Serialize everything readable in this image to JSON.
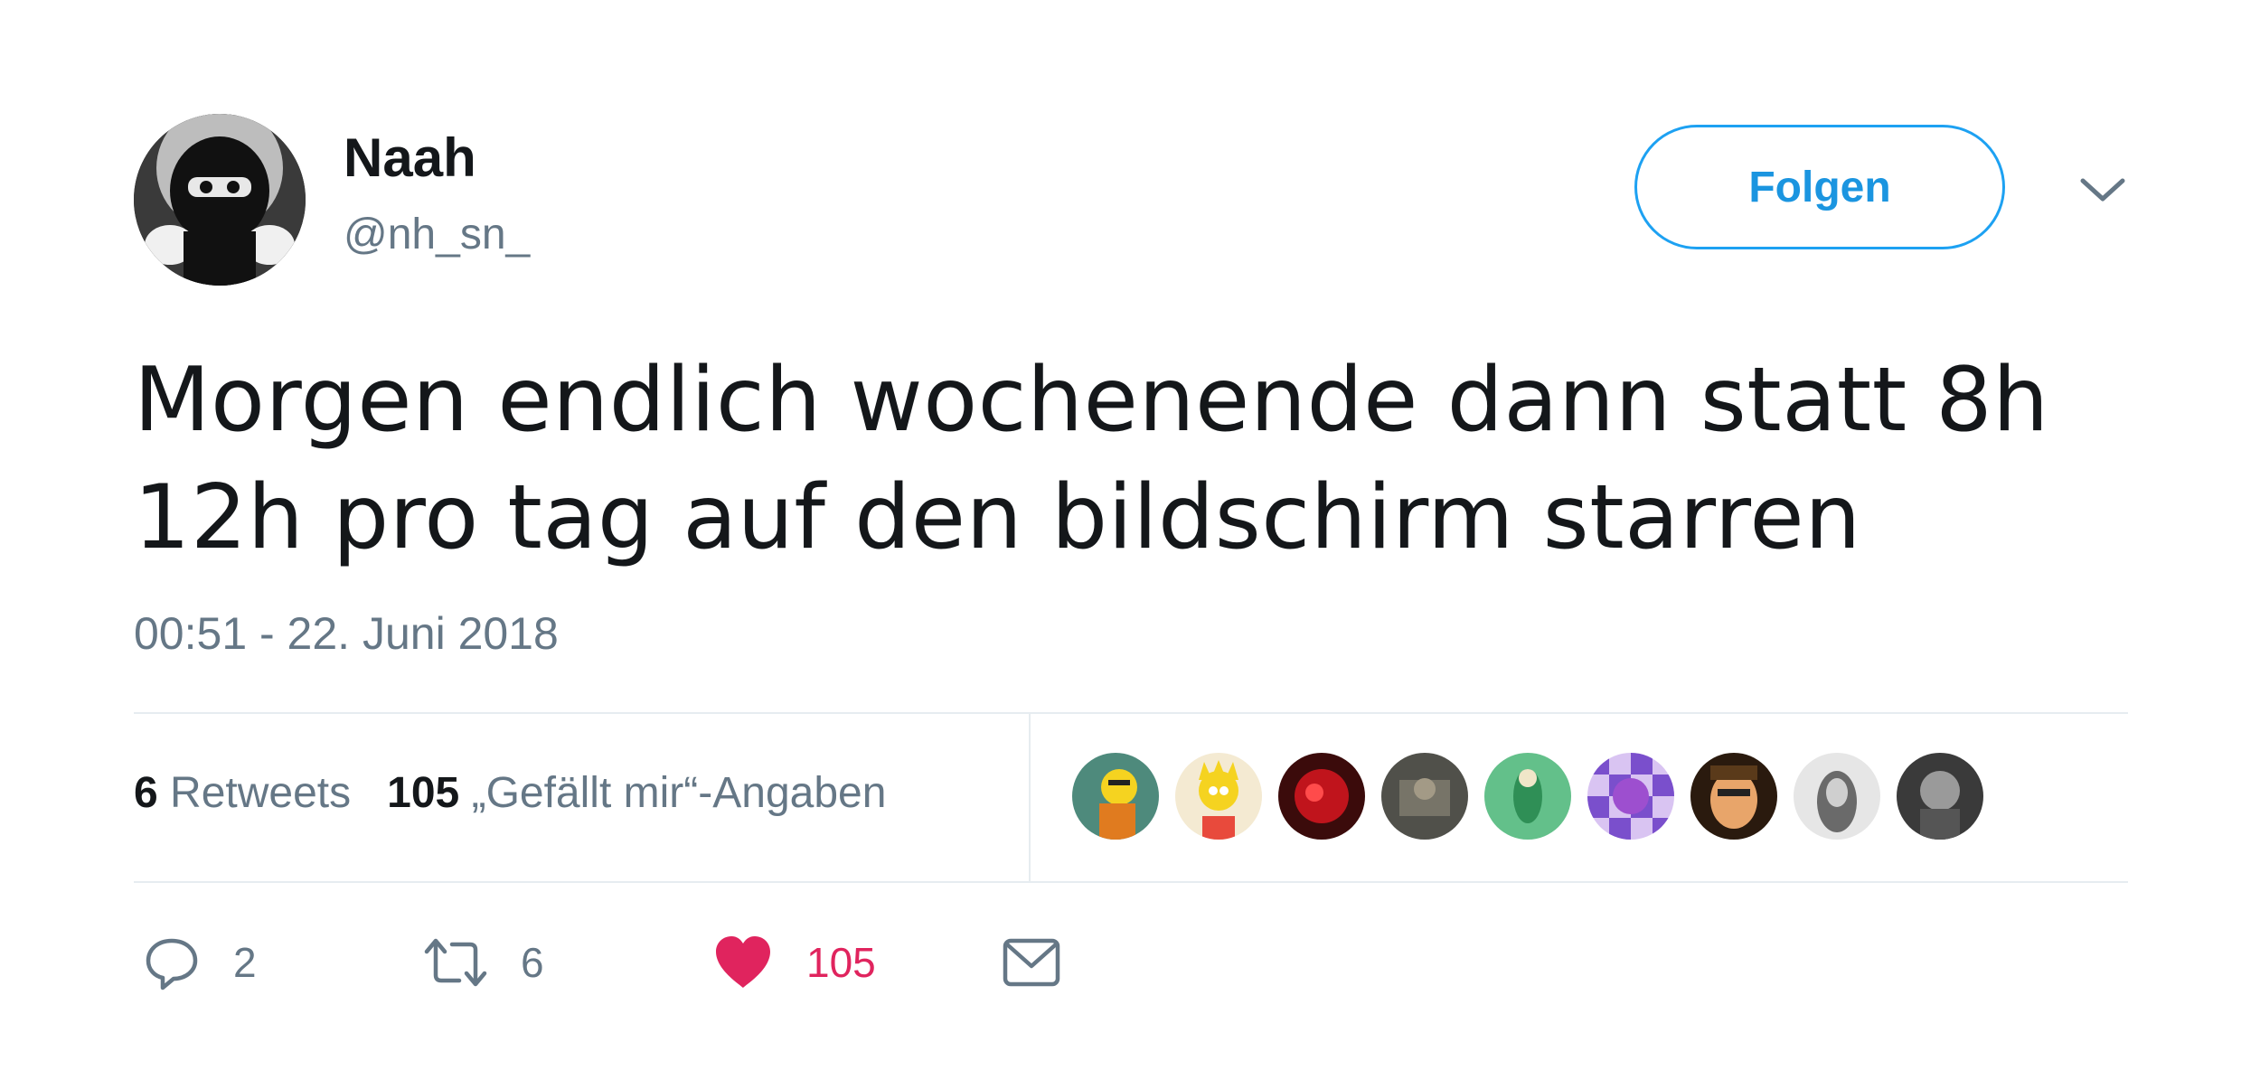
{
  "user": {
    "name": "Naah",
    "handle": "@nh_sn_"
  },
  "follow_button": {
    "label": "Folgen"
  },
  "tweet": {
    "text": "Morgen endlich wochenende dann statt 8h 12h pro tag auf den bildschirm starren",
    "timestamp": "00:51 - 22. Juni 2018"
  },
  "stats": {
    "retweets_count": "6",
    "retweets_label": "Retweets",
    "likes_count": "105",
    "likes_label": "„Gefällt mir“-Angaben"
  },
  "likers_count_shown": 9,
  "actions": {
    "reply_count": "2",
    "retweet_count": "6",
    "like_count": "105"
  },
  "colors": {
    "accent": "#1da1f2",
    "like": "#e0245e",
    "muted": "#657786",
    "text": "#14171a",
    "divider": "#e6ecf0"
  },
  "icons": {
    "dropdown": "chevron-down-icon",
    "reply": "reply-icon",
    "retweet": "retweet-icon",
    "like": "heart-icon",
    "message": "envelope-icon"
  }
}
